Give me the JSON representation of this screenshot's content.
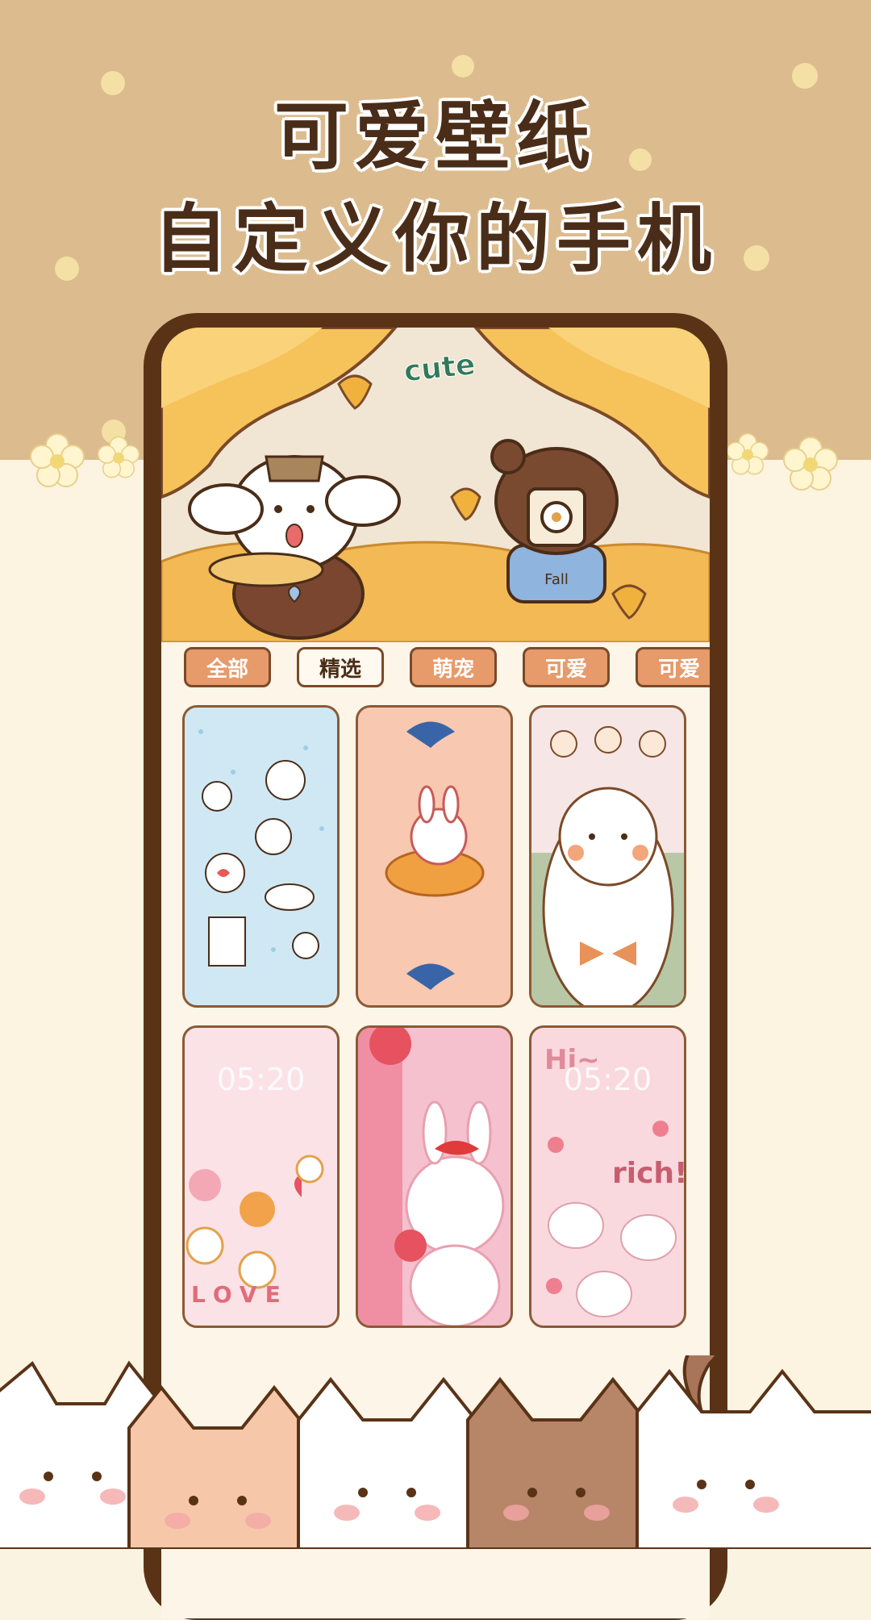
{
  "headline": {
    "line1": "可爱壁纸",
    "line2": "自定义你的手机"
  },
  "banner": {
    "sticker_text": "cute",
    "bear_shirt_text": "Fall"
  },
  "tabs": [
    {
      "label": "全部",
      "active": false
    },
    {
      "label": "精选",
      "active": true
    },
    {
      "label": "萌宠",
      "active": false
    },
    {
      "label": "可爱",
      "active": false
    },
    {
      "label": "可爱",
      "active": false
    }
  ],
  "wallpapers": [
    {
      "name": "white dogs and bunnies"
    },
    {
      "name": "bunny on fish"
    },
    {
      "name": "alpaca with bow"
    },
    {
      "name": "520 love cats",
      "time": "05:20",
      "text": "LOVE",
      "numbers": "520"
    },
    {
      "name": "strawberry bunny"
    },
    {
      "name": "rich bunnies",
      "greeting": "Hi~",
      "time": "05:20",
      "text": "rich!"
    }
  ],
  "colors": {
    "top_bg": "#dcbc8e",
    "bottom_bg": "#fcf3e1",
    "frame": "#5a3317",
    "tab_orange": "#e79a6a"
  }
}
